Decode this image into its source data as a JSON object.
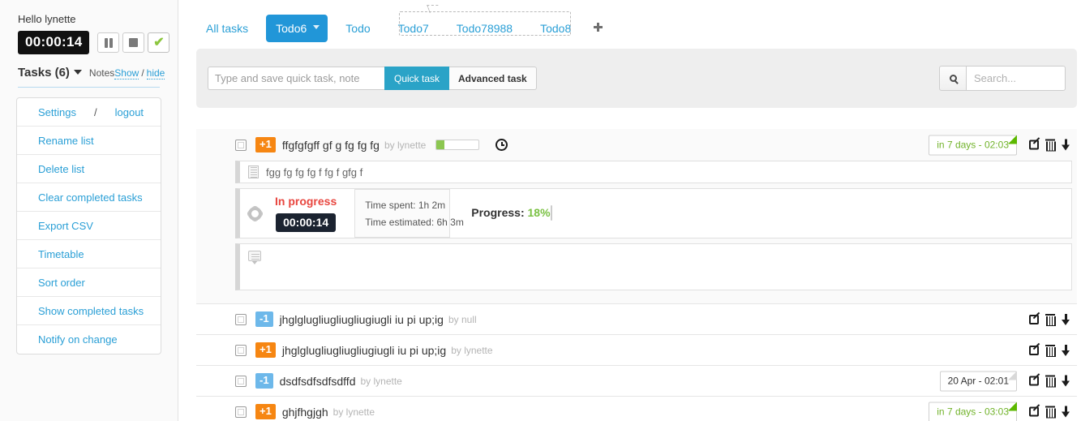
{
  "sidebar": {
    "greeting": "Hello lynette",
    "timer_value": "00:00:14",
    "buttons": {
      "pause": "pause",
      "stop": "stop",
      "done": "done"
    },
    "tasks_title": "Tasks (6)",
    "notes_label": "Notes",
    "notes_show": "Show",
    "notes_sep": "/",
    "notes_hide": "hide",
    "menu": [
      {
        "label": "Settings",
        "sep": "/",
        "label2": "logout",
        "type": "split"
      },
      {
        "label": "Rename list"
      },
      {
        "label": "Delete list"
      },
      {
        "label": "Clear completed tasks"
      },
      {
        "label": "Export CSV"
      },
      {
        "label": "Timetable"
      },
      {
        "label": "Sort order"
      },
      {
        "label": "Show completed tasks"
      },
      {
        "label": "Notify on change"
      }
    ]
  },
  "tabs": {
    "items": [
      {
        "label": "All tasks",
        "active": false
      },
      {
        "label": "Todo6",
        "active": true
      },
      {
        "label": "Todo",
        "active": false
      },
      {
        "label": "Todo7",
        "active": false
      },
      {
        "label": "Todo78988",
        "active": false
      },
      {
        "label": "Todo8",
        "active": false
      }
    ],
    "add_label": "+"
  },
  "quickbar": {
    "input_placeholder": "Type and save quick task, note",
    "input_value": "",
    "quick_task_label": "Quick task",
    "advanced_task_label": "Advanced task",
    "search_placeholder": "Search...",
    "search_value": ""
  },
  "task_detail": {
    "priority": "+1",
    "title": "ffgfgfgff gf g fg fg fg",
    "by": "by lynette",
    "mini_progress_percent": 18,
    "due": "in 7 days - 02:03",
    "note_text": "fgg fg fg fg f fg f gfg f",
    "status_label": "In progress",
    "status_timer": "00:00:14",
    "time_spent": "Time spent: 1h 2m",
    "time_estimated": "Time estimated: 6h 3m",
    "progress_label": "Progress:",
    "progress_value": "18%",
    "progress_percent": 18
  },
  "tasks": [
    {
      "priority": "-1",
      "priority_dir": "down",
      "title": "jhglglugliugliugliugiugli iu pi up;ig",
      "by": "by null",
      "due": "",
      "due_style": ""
    },
    {
      "priority": "+1",
      "priority_dir": "up",
      "title": "jhglglugliugliugliugiugli iu pi up;ig",
      "by": "by lynette",
      "due": "",
      "due_style": ""
    },
    {
      "priority": "-1",
      "priority_dir": "down",
      "title": "dsdfsdfsdfsdffd",
      "by": "by lynette",
      "due": "20 Apr - 02:01",
      "due_style": "plain"
    },
    {
      "priority": "+1",
      "priority_dir": "up",
      "title": "ghjfhgjgh",
      "by": "by lynette",
      "due": "in 7 days - 03:03",
      "due_style": "green"
    }
  ],
  "colors": {
    "accent_blue": "#2196d8",
    "link_blue": "#2a9fd6",
    "priority_up": "#f68612",
    "priority_down": "#6db8ea",
    "progress_green": "#8cc751",
    "status_red": "#e8463f",
    "due_green": "#72b32b"
  }
}
